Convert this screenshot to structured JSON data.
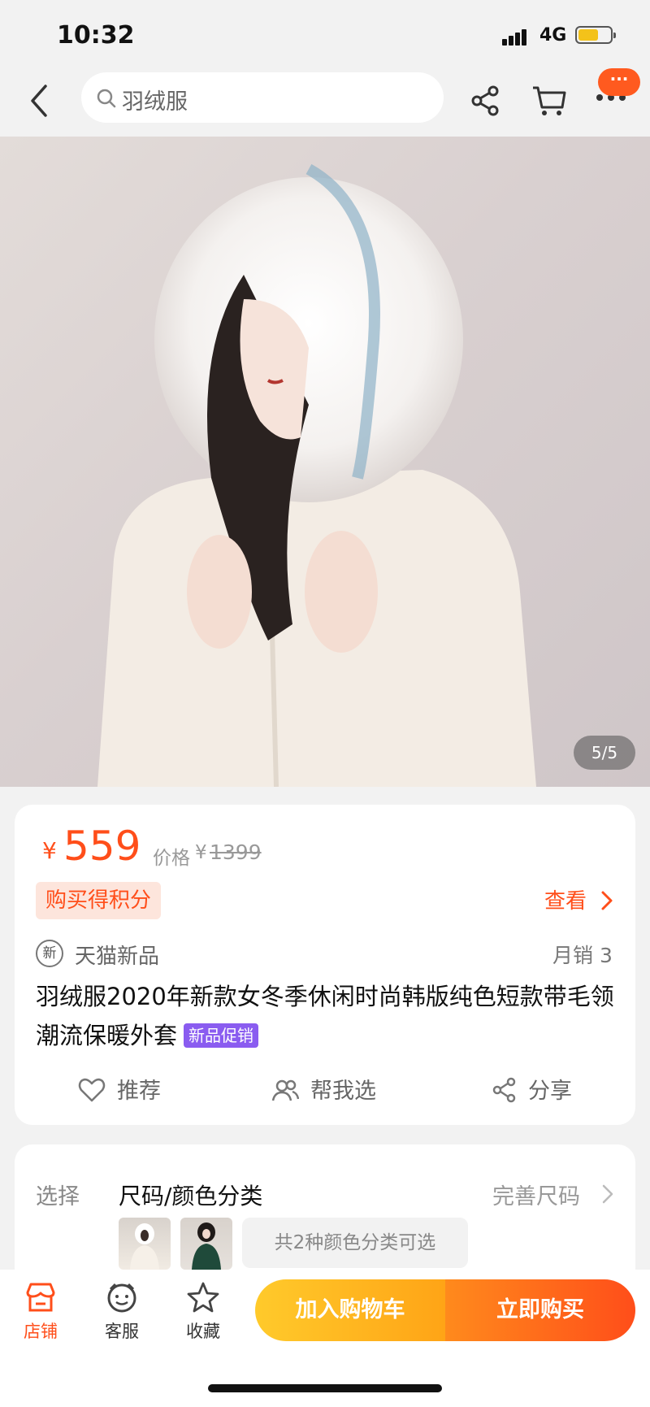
{
  "status": {
    "time": "10:32",
    "network": "4G"
  },
  "nav": {
    "search_text": "羽绒服",
    "badge_text": "···"
  },
  "hero": {
    "pager": "5/5"
  },
  "price": {
    "currency": "¥",
    "current": "559",
    "original_label": "价格",
    "original_currency": "¥",
    "original": "1399",
    "points_label": "购买得积分",
    "view_link": "查看"
  },
  "product": {
    "tag_icon": "新",
    "tag_text": "天猫新品",
    "monthly_sales": "月销 3",
    "title": "羽绒服2020年新款女冬季休闲时尚韩版纯色短款带毛领潮流保暖外套",
    "promo_badge": "新品促销"
  },
  "actions": {
    "recommend": "推荐",
    "help_choose": "帮我选",
    "share": "分享"
  },
  "options": {
    "label": "选择",
    "value": "尺码/颜色分类",
    "size_link": "完善尺码",
    "colors_text": "共2种颜色分类可选"
  },
  "bottom": {
    "store": "店铺",
    "service": "客服",
    "favorite": "收藏",
    "add_to_cart": "加入购物车",
    "buy_now": "立即购买"
  },
  "colors": {
    "accent": "#ff4e1a",
    "promo": "#8a5cf0",
    "cart_button": "#ffb21f"
  },
  "icons": [
    "back-icon",
    "search-icon",
    "share-icon",
    "cart-icon",
    "more-icon",
    "heart-icon",
    "people-icon",
    "store-icon",
    "service-icon",
    "star-icon",
    "chevron-right-icon"
  ]
}
